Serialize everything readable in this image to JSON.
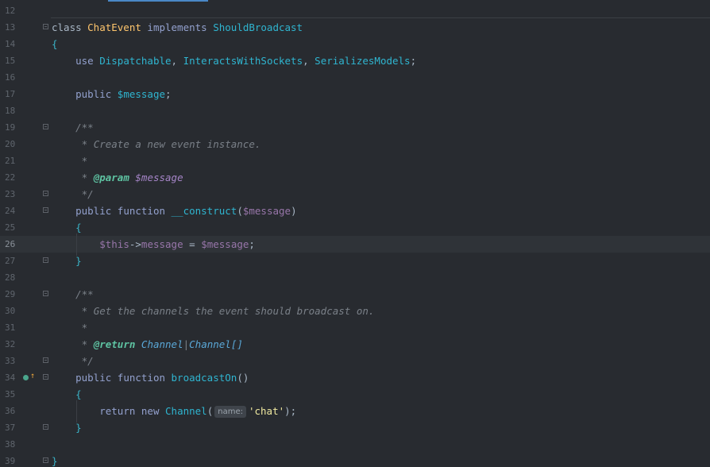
{
  "editor": {
    "lines": [
      {
        "n": "12",
        "tokens": []
      },
      {
        "n": "13",
        "tokens": [
          [
            "plain",
            "class "
          ],
          [
            "cls-y",
            "ChatEvent"
          ],
          [
            "kw2",
            " implements "
          ],
          [
            "cls",
            "ShouldBroadcast"
          ]
        ]
      },
      {
        "n": "14",
        "tokens": [
          [
            "brace",
            "{"
          ]
        ]
      },
      {
        "n": "15",
        "tokens": [
          [
            "plain",
            "    "
          ],
          [
            "kw2",
            "use "
          ],
          [
            "cls",
            "Dispatchable"
          ],
          [
            "plain",
            ", "
          ],
          [
            "cls",
            "InteractsWithSockets"
          ],
          [
            "plain",
            ", "
          ],
          [
            "cls",
            "SerializesModels"
          ],
          [
            "plain",
            ";"
          ]
        ]
      },
      {
        "n": "16",
        "tokens": []
      },
      {
        "n": "17",
        "tokens": [
          [
            "plain",
            "    "
          ],
          [
            "kw2",
            "public "
          ],
          [
            "cls",
            "$message"
          ],
          [
            "plain",
            ";"
          ]
        ]
      },
      {
        "n": "18",
        "tokens": []
      },
      {
        "n": "19",
        "tokens": [
          [
            "plain",
            "    "
          ],
          [
            "cmt",
            "/**"
          ]
        ]
      },
      {
        "n": "20",
        "tokens": [
          [
            "plain",
            "     "
          ],
          [
            "cmt",
            "* Create a new event instance."
          ]
        ]
      },
      {
        "n": "21",
        "tokens": [
          [
            "plain",
            "     "
          ],
          [
            "cmt",
            "*"
          ]
        ]
      },
      {
        "n": "22",
        "tokens": [
          [
            "plain",
            "     "
          ],
          [
            "cmt",
            "* "
          ],
          [
            "tag",
            "@param"
          ],
          [
            "cmt",
            " "
          ],
          [
            "tagvar",
            "$message"
          ]
        ]
      },
      {
        "n": "23",
        "tokens": [
          [
            "plain",
            "     "
          ],
          [
            "cmt",
            "*/"
          ]
        ]
      },
      {
        "n": "24",
        "tokens": [
          [
            "plain",
            "    "
          ],
          [
            "kw2",
            "public function "
          ],
          [
            "cls",
            "__construct"
          ],
          [
            "plain",
            "("
          ],
          [
            "var",
            "$message"
          ],
          [
            "plain",
            ")"
          ]
        ]
      },
      {
        "n": "25",
        "tokens": [
          [
            "plain",
            "    "
          ],
          [
            "brace",
            "{"
          ]
        ]
      },
      {
        "n": "26",
        "tokens": [
          [
            "plain",
            "        "
          ],
          [
            "var",
            "$this"
          ],
          [
            "plain",
            "->"
          ],
          [
            "var",
            "message"
          ],
          [
            "plain",
            " = "
          ],
          [
            "var",
            "$message"
          ],
          [
            "plain",
            ";"
          ]
        ]
      },
      {
        "n": "27",
        "tokens": [
          [
            "plain",
            "    "
          ],
          [
            "brace",
            "}"
          ]
        ]
      },
      {
        "n": "28",
        "tokens": []
      },
      {
        "n": "29",
        "tokens": [
          [
            "plain",
            "    "
          ],
          [
            "cmt",
            "/**"
          ]
        ]
      },
      {
        "n": "30",
        "tokens": [
          [
            "plain",
            "     "
          ],
          [
            "cmt",
            "* Get the channels the event should broadcast on."
          ]
        ]
      },
      {
        "n": "31",
        "tokens": [
          [
            "plain",
            "     "
          ],
          [
            "cmt",
            "*"
          ]
        ]
      },
      {
        "n": "32",
        "tokens": [
          [
            "plain",
            "     "
          ],
          [
            "cmt",
            "* "
          ],
          [
            "tag",
            "@return"
          ],
          [
            "cmt",
            " "
          ],
          [
            "tagtype",
            "Channel"
          ],
          [
            "cmt",
            "|"
          ],
          [
            "tagtype",
            "Channel[]"
          ]
        ]
      },
      {
        "n": "33",
        "tokens": [
          [
            "plain",
            "     "
          ],
          [
            "cmt",
            "*/"
          ]
        ]
      },
      {
        "n": "34",
        "tokens": [
          [
            "plain",
            "    "
          ],
          [
            "kw2",
            "public function "
          ],
          [
            "cls",
            "broadcastOn"
          ],
          [
            "plain",
            "()"
          ]
        ]
      },
      {
        "n": "35",
        "tokens": [
          [
            "plain",
            "    "
          ],
          [
            "brace",
            "{"
          ]
        ]
      },
      {
        "n": "36",
        "tokens": [
          [
            "plain",
            "        "
          ],
          [
            "kw2",
            "return new "
          ],
          [
            "cls",
            "Channel"
          ],
          [
            "plain",
            "("
          ],
          [
            "hint",
            "name:"
          ],
          [
            "str",
            "'chat'"
          ],
          [
            "plain",
            ");"
          ]
        ]
      },
      {
        "n": "37",
        "tokens": [
          [
            "plain",
            "    "
          ],
          [
            "brace",
            "}"
          ]
        ]
      },
      {
        "n": "38",
        "tokens": []
      },
      {
        "n": "39",
        "tokens": [
          [
            "brace",
            "}"
          ]
        ]
      }
    ],
    "current_line": "26",
    "fold_lines": [
      "13",
      "19",
      "23",
      "24",
      "27",
      "29",
      "33",
      "34",
      "37",
      "39"
    ],
    "gutter_marker_line": "34"
  },
  "colors": {
    "background": "#282b30",
    "current_line": "#2f3338",
    "accent": "#4a88c7"
  }
}
